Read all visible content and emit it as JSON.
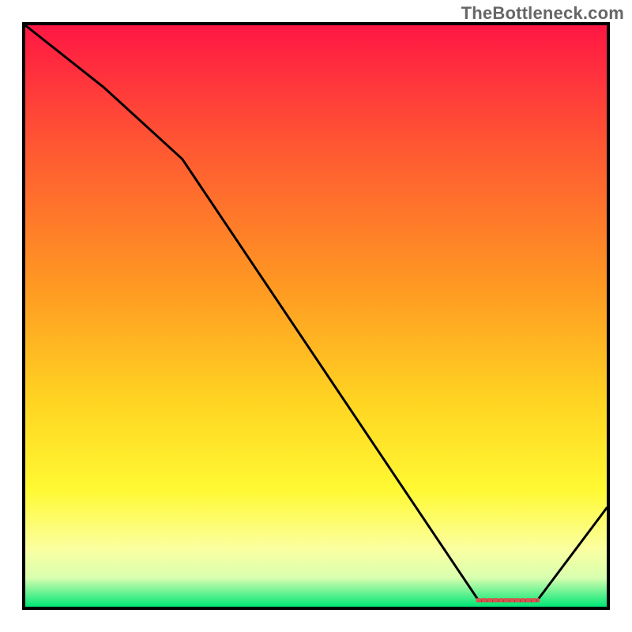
{
  "watermark": "TheBottleneck.com",
  "chart_data": {
    "type": "line",
    "title": "",
    "xlabel": "",
    "ylabel": "",
    "xlim": [
      0,
      100
    ],
    "ylim": [
      0,
      100
    ],
    "x": [
      0,
      27,
      78,
      88,
      100
    ],
    "values": [
      100,
      77,
      1,
      1,
      17
    ],
    "marker_label": "",
    "marker_color": "#d9534f",
    "gradient_stops": [
      {
        "offset": 0.0,
        "color": "#ff1744"
      },
      {
        "offset": 0.2,
        "color": "#ff5533"
      },
      {
        "offset": 0.45,
        "color": "#ff9922"
      },
      {
        "offset": 0.65,
        "color": "#ffd522"
      },
      {
        "offset": 0.8,
        "color": "#fff933"
      },
      {
        "offset": 0.9,
        "color": "#fbffa0"
      },
      {
        "offset": 0.95,
        "color": "#d9ffb0"
      },
      {
        "offset": 1.0,
        "color": "#00e676"
      }
    ]
  }
}
